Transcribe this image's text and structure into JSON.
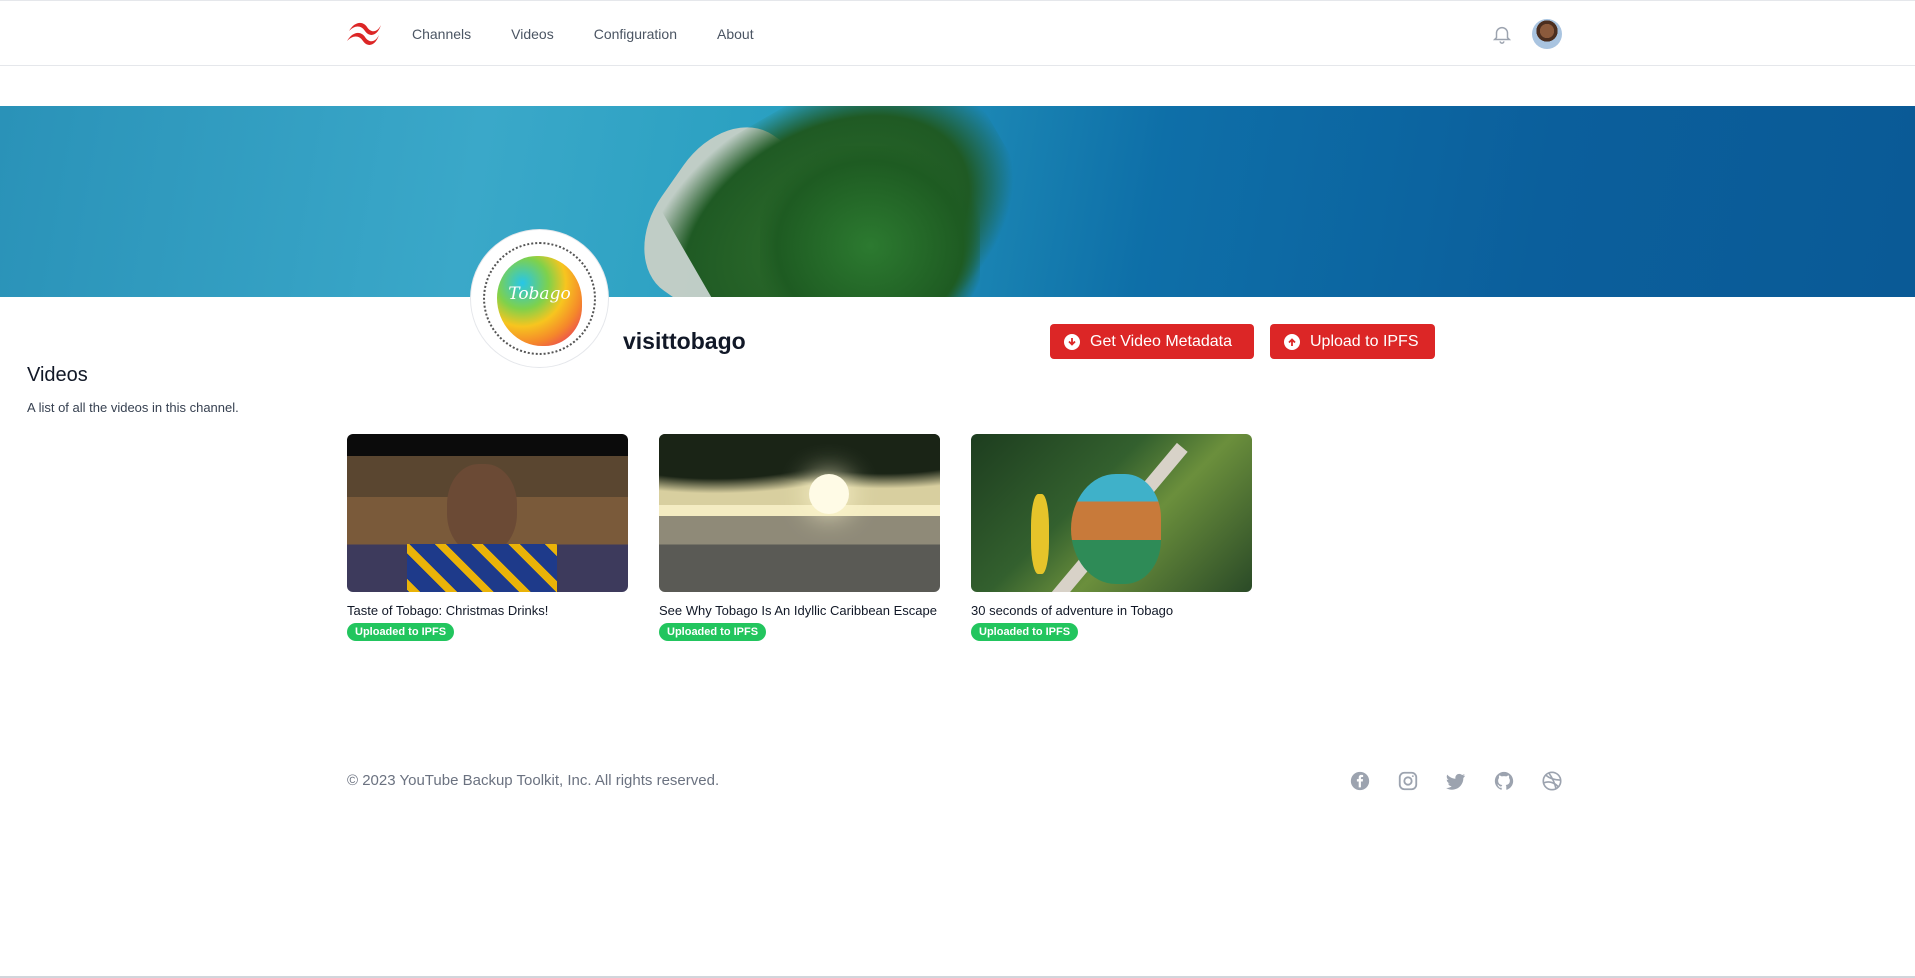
{
  "nav": {
    "links": [
      "Channels",
      "Videos",
      "Configuration",
      "About"
    ],
    "logo_icon": "tailwind-wave-logo",
    "notification_icon": "bell-icon",
    "brand_color": "#dc2626"
  },
  "channel": {
    "name": "visittobago",
    "avatar_text": "Tobago",
    "banner_description_icon": "island-aerial-banner"
  },
  "actions": {
    "get_metadata_label": "Get Video Metadata",
    "upload_label": "Upload to IPFS",
    "button_color": "#dc2626"
  },
  "section": {
    "title": "Videos",
    "subtitle": "A list of all the videos in this channel."
  },
  "videos": [
    {
      "title": "Taste of Tobago: Christmas Drinks!",
      "status": "Uploaded to IPFS"
    },
    {
      "title": "See Why Tobago Is An Idyllic Caribbean Escape",
      "status": "Uploaded to IPFS"
    },
    {
      "title": "30 seconds of adventure in Tobago",
      "status": "Uploaded to IPFS"
    }
  ],
  "footer": {
    "copyright": "© 2023 YouTube Backup Toolkit, Inc. All rights reserved.",
    "social_icons": [
      "facebook-icon",
      "instagram-icon",
      "twitter-icon",
      "github-icon",
      "dribbble-icon"
    ]
  },
  "colors": {
    "badge_green": "#22c55e"
  }
}
